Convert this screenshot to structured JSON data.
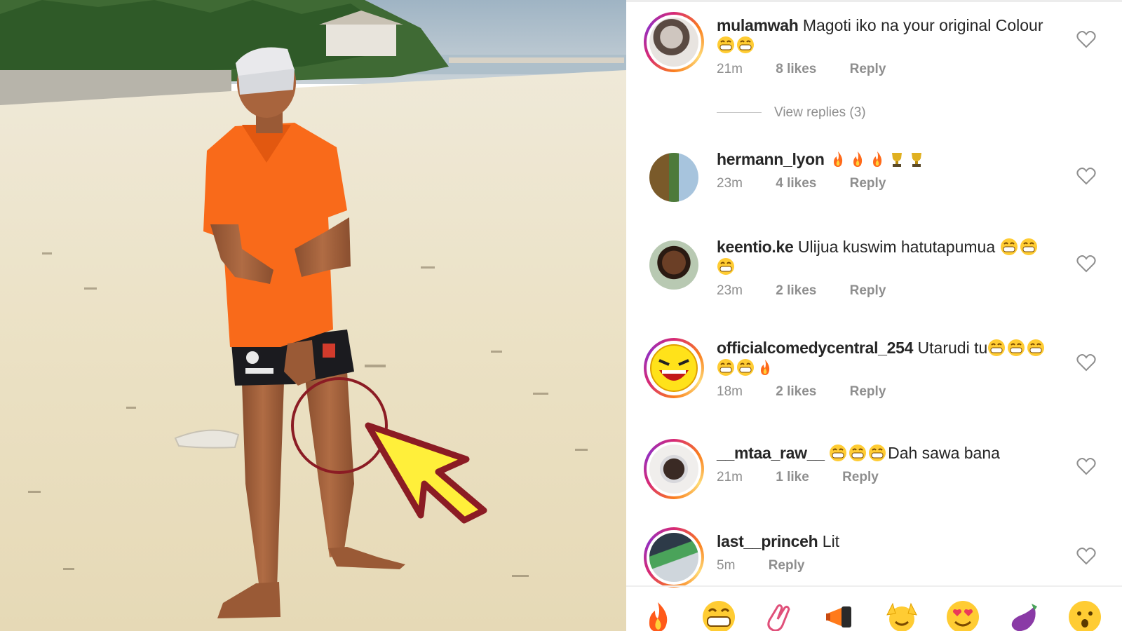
{
  "comments": [
    {
      "username": "mulamwah",
      "text": "Magoti iko na your original Colour",
      "emojis": [
        "grin",
        "grin"
      ],
      "emoji_line": "second",
      "time": "21m",
      "likes": "8 likes",
      "reply": "Reply",
      "avatar_ring": true
    },
    {
      "username": "hermann_lyon",
      "text": "",
      "emojis": [
        "fire",
        "fire",
        "fire",
        "trophy",
        "trophy"
      ],
      "emoji_line": "inline",
      "time": "23m",
      "likes": "4 likes",
      "reply": "Reply",
      "avatar_ring": false
    },
    {
      "username": "keentio.ke",
      "text": "Ulijua kuswim hatutapumua",
      "emojis": [
        "grin",
        "grin",
        "grin"
      ],
      "emoji_line": "split",
      "time": "23m",
      "likes": "2 likes",
      "reply": "Reply",
      "avatar_ring": false
    },
    {
      "username": "officialcomedycentral_254",
      "text": "Utarudi tu",
      "emojis": [
        "grin",
        "grin",
        "grin",
        "grin",
        "grin",
        "fire"
      ],
      "emoji_line": "split",
      "time": "18m",
      "likes": "2 likes",
      "reply": "Reply",
      "avatar_ring": true
    },
    {
      "username": "__mtaa_raw__",
      "text": "Dah sawa bana",
      "emojis": [
        "grin",
        "grin",
        "grin"
      ],
      "emoji_line": "before",
      "time": "21m",
      "likes": "1 like",
      "reply": "Reply",
      "avatar_ring": true
    },
    {
      "username": "last__princeh",
      "text": "Lit",
      "emojis": [],
      "emoji_line": "none",
      "time": "5m",
      "likes": "",
      "reply": "Reply",
      "avatar_ring": true
    }
  ],
  "view_replies": "View replies (3)",
  "emoji_bar": [
    "fire-emoji",
    "grin-emoji",
    "clap-emoji",
    "megaphone-emoji",
    "raised-hands-emoji",
    "heart-eyes-emoji",
    "eggplant-emoji",
    "surprised-emoji"
  ],
  "colors": {
    "text": "#262626",
    "muted": "#8e8e8e",
    "shirt": "#f96a1a",
    "arrow": "#ffef3a",
    "arrow_outline": "#8b1c24"
  }
}
